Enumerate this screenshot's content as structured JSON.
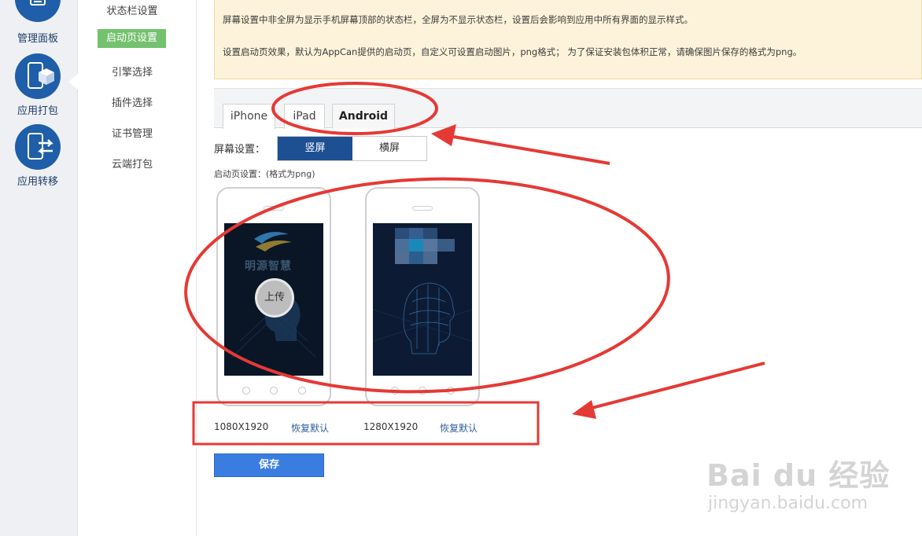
{
  "left_rail": {
    "items": [
      {
        "label": "管理面板",
        "icon": "dashboard-icon"
      },
      {
        "label": "应用打包",
        "icon": "package-icon"
      },
      {
        "label": "应用转移",
        "icon": "transfer-icon"
      }
    ]
  },
  "sub_nav": {
    "items": [
      {
        "label": "状态栏设置"
      },
      {
        "label": "启动页设置"
      },
      {
        "label": "引擎选择"
      },
      {
        "label": "插件选择"
      },
      {
        "label": "证书管理"
      },
      {
        "label": "云端打包"
      }
    ],
    "active": "启动页设置"
  },
  "notice": {
    "line1": "屏幕设置中非全屏为显示手机屏幕顶部的状态栏，全屏为不显示状态栏，设置后会影响到应用中所有界面的显示样式。",
    "line2": "设置启动页效果，默认为AppCan提供的启动页，自定义可设置启动图片，png格式； 为了保证安装包体积正常，请确保图片保存的格式为png。"
  },
  "tabs": [
    {
      "label": "iPhone"
    },
    {
      "label": "iPad"
    },
    {
      "label": "Android"
    }
  ],
  "active_tab": "Android",
  "screen_setting": {
    "label": "屏幕设置：",
    "portrait": "竖屏",
    "landscape": "横屏",
    "selected": "竖屏"
  },
  "launch_label": "启动页设置：(格式为png)",
  "phones": [
    {
      "size": "1080X1920",
      "restore": "恢复默认",
      "upload": "上传",
      "logo_text": "明源智慧"
    },
    {
      "size": "1280X1920",
      "restore": "恢复默认"
    }
  ],
  "save_label": "保存",
  "watermark": {
    "brand": "Bai du 经验",
    "url": "jingyan.baidu.com"
  },
  "colors": {
    "rail_bg": "#eef0f4",
    "icon_blue": "#1f5ea8",
    "active_sub": "#74c16e",
    "notice_bg": "#fdf3da",
    "orient_on": "#1d4f93",
    "save_btn": "#3a7de0",
    "annotation_red": "#e53935"
  }
}
